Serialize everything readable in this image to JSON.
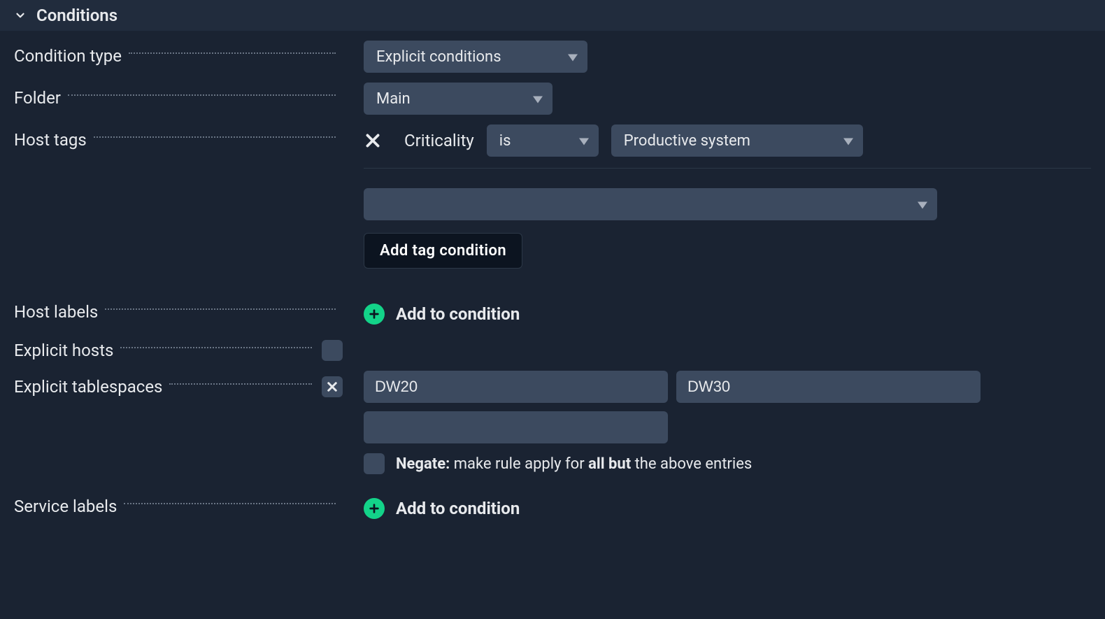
{
  "section": {
    "title": "Conditions"
  },
  "labels": {
    "condition_type": "Condition type",
    "folder": "Folder",
    "host_tags": "Host tags",
    "host_labels": "Host labels",
    "explicit_hosts": "Explicit hosts",
    "explicit_tablespaces": "Explicit tablespaces",
    "service_labels": "Service labels"
  },
  "condition_type": {
    "selected": "Explicit conditions"
  },
  "folder": {
    "selected": "Main"
  },
  "host_tags": {
    "tag_label": "Criticality",
    "operator": "is",
    "value": "Productive system",
    "new_tag_selected": "",
    "add_button": "Add tag condition"
  },
  "host_labels": {
    "add_text": "Add to condition"
  },
  "explicit_tablespaces": {
    "values": [
      "DW20",
      "DW30",
      ""
    ],
    "negate_bold": "Negate:",
    "negate_mid": " make rule apply for ",
    "negate_bold2": "all but",
    "negate_tail": " the above entries"
  },
  "service_labels": {
    "add_text": "Add to condition"
  }
}
